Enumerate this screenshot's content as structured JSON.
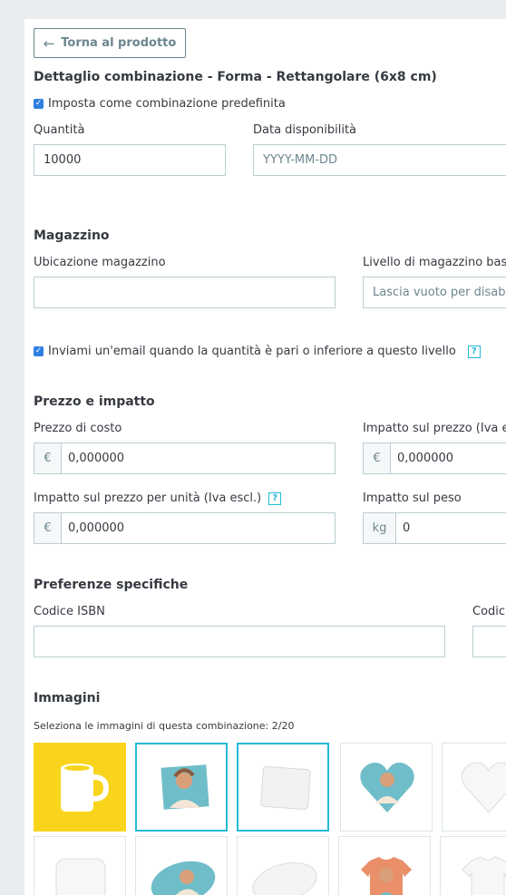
{
  "back_button": {
    "label": "Torna al prodotto",
    "icon": "arrow-left-icon"
  },
  "title": "Dettaglio combinazione - Forma - Rettangolare (6x8 cm)",
  "default_checkbox": {
    "label": "Imposta come combinazione predefinita",
    "checked": true
  },
  "quantity": {
    "label": "Quantità",
    "value": "10000"
  },
  "availability_date": {
    "label": "Data disponibilità",
    "placeholder": "YYYY-MM-DD"
  },
  "stock": {
    "heading": "Magazzino",
    "location_label": "Ubicazione magazzino",
    "location_value": "",
    "low_stock_label": "Livello di magazzino bas",
    "low_stock_placeholder": "Lascia vuoto per disabi",
    "email_alert": {
      "label": "Inviami un'email quando la quantità è pari o inferiore a questo livello",
      "checked": true,
      "help": "?"
    }
  },
  "price": {
    "heading": "Prezzo e impatto",
    "cost_label": "Prezzo di costo",
    "cost_currency": "€",
    "cost_value": "0,000000",
    "impact_label": "Impatto sul prezzo (Iva e",
    "impact_currency": "€",
    "impact_value": "0,000000",
    "unit_impact_label": "Impatto sul prezzo per unità (Iva escl.)",
    "unit_impact_help": "?",
    "unit_impact_currency": "€",
    "unit_impact_value": "0,000000",
    "weight_label": "Impatto sul peso",
    "weight_unit": "kg",
    "weight_value": "0"
  },
  "specific": {
    "heading": "Preferenze specifiche",
    "isbn_label": "Codice ISBN",
    "isbn_value": "",
    "code2_label": "Codic",
    "code2_value": ""
  },
  "images": {
    "heading": "Immagini",
    "caption": "Seleziona le immagini di questa combinazione: 2/20",
    "thumbnails": [
      {
        "name": "mug-image",
        "selected": false
      },
      {
        "name": "rectangular-photo-magnet-image",
        "selected": true
      },
      {
        "name": "blank-rectangle-image",
        "selected": true
      },
      {
        "name": "heart-photo-magnet-image",
        "selected": false
      },
      {
        "name": "blank-heart-image",
        "selected": false
      },
      {
        "name": "pillow-image",
        "selected": false
      },
      {
        "name": "oval-photo-image",
        "selected": false
      },
      {
        "name": "blank-oval-image",
        "selected": false
      },
      {
        "name": "photo-tshirt-image",
        "selected": false
      },
      {
        "name": "blank-tshirt-image",
        "selected": false
      }
    ]
  },
  "colors": {
    "accent": "#25b9d7",
    "checkbox": "#2e7fe0",
    "mug_bg": "#f8d51c",
    "border": "#bbcdd2"
  }
}
